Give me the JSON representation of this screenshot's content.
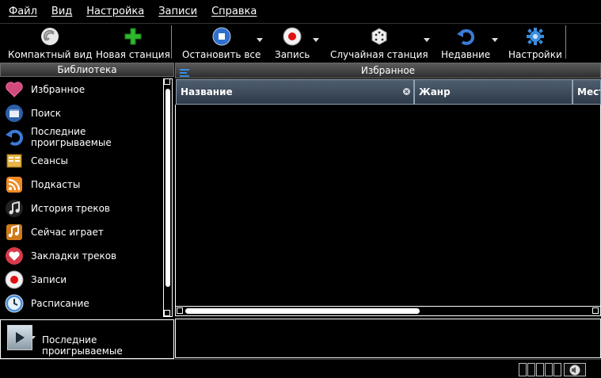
{
  "menu": [
    "Файл",
    "Вид",
    "Настройка",
    "Записи",
    "Справка"
  ],
  "toolbar": {
    "compact": "Компактный вид",
    "new_station": "Новая станция",
    "stop_all": "Остановить все",
    "record": "Запись",
    "random": "Случайная станция",
    "recent": "Недавние",
    "settings": "Настройки"
  },
  "library": {
    "title": "Библиотека",
    "items": [
      {
        "label": "Избранное",
        "icon": "heart-icon"
      },
      {
        "label": "Поиск",
        "icon": "search-window-icon"
      },
      {
        "label": "Последние проигрываемые",
        "icon": "history-arrow-icon"
      },
      {
        "label": "Сеансы",
        "icon": "sessions-icon"
      },
      {
        "label": "Подкасты",
        "icon": "rss-icon"
      },
      {
        "label": "История треков",
        "icon": "music-note-icon"
      },
      {
        "label": "Сейчас играет",
        "icon": "now-playing-icon"
      },
      {
        "label": "Закладки треков",
        "icon": "bookmark-heart-icon"
      },
      {
        "label": "Записи",
        "icon": "record-icon"
      },
      {
        "label": "Расписание",
        "icon": "clock-icon"
      }
    ]
  },
  "player": {
    "label": "Последние проигрываемые"
  },
  "main": {
    "title": "Избранное",
    "columns": [
      "Название",
      "Жанр",
      "Мест"
    ]
  },
  "colors": {
    "header_blue": "#3e4b5b",
    "accent_blue": "#3a7bd5",
    "record_red": "#e01010",
    "green_plus": "#2db82d"
  }
}
